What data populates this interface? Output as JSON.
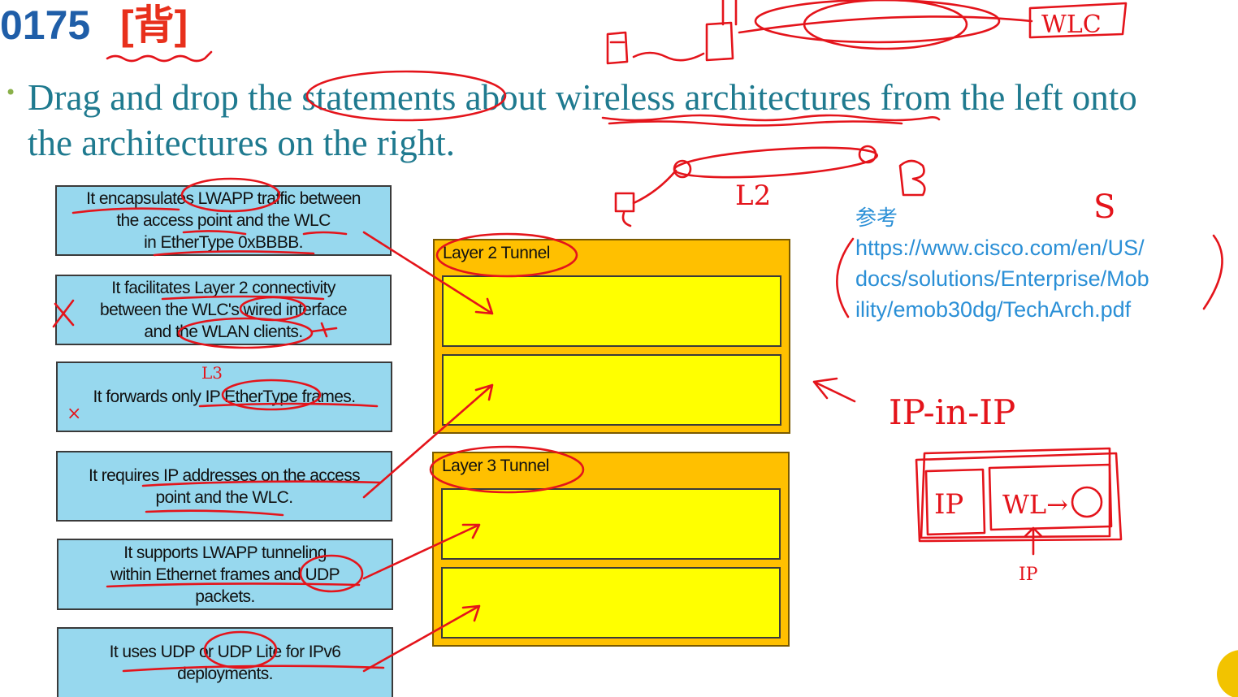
{
  "header": {
    "question_number": "0175",
    "question_tag": "[背]"
  },
  "question": {
    "line1": "Drag and drop the statements about wireless architectures from the left onto",
    "line2": "the architectures on the right."
  },
  "statements": [
    {
      "lines": [
        "It encapsulates LWAPP traffic between",
        "the access point and the WLC",
        "in EtherType 0xBBBB."
      ]
    },
    {
      "lines": [
        "It facilitates Layer 2 connectivity",
        "between the WLC's wired interface",
        "and the WLAN clients."
      ]
    },
    {
      "lines": [
        "It forwards only IP EtherType frames."
      ]
    },
    {
      "lines": [
        "It requires IP addresses on the access",
        "point and the WLC."
      ]
    },
    {
      "lines": [
        "It supports LWAPP tunneling",
        "within Ethernet frames and UDP",
        "packets."
      ]
    },
    {
      "lines": [
        "It uses UDP or UDP Lite for IPv6",
        "deployments."
      ]
    }
  ],
  "architectures": [
    {
      "label": "Layer 2 Tunnel"
    },
    {
      "label": "Layer 3 Tunnel"
    }
  ],
  "reference": {
    "label": "参考",
    "url_lines": [
      "https://www.cisco.com/en/US/",
      "docs/solutions/Enterprise/Mob",
      "ility/emob30dg/TechArch.pdf"
    ]
  },
  "annotations": {
    "wlc": "WLC",
    "l2": "L2",
    "ip_in_ip": "IP-in-IP",
    "ip_box": "IP",
    "wl_box": "WL→",
    "ip_small": "IP",
    "l3": "L3",
    "cross": "×",
    "s_mark": "S"
  },
  "colors": {
    "statement_fill": "#97d8ee",
    "architecture_fill": "#ffc000",
    "slot_fill": "#ffff00",
    "ink": "#e4141b",
    "title": "#1f5ea8",
    "question_text": "#1f7a8f",
    "link": "#2a8fd6"
  }
}
